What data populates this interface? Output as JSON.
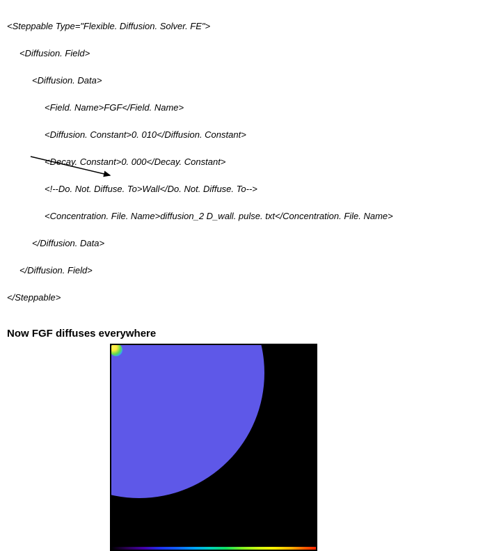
{
  "xml": {
    "l0": "<Steppable Type=\"Flexible. Diffusion. Solver. FE\">",
    "l1": "<Diffusion. Field>",
    "l2": "<Diffusion. Data>",
    "l3": "<Field. Name>FGF</Field. Name>",
    "l4": "<Diffusion. Constant>0. 010</Diffusion. Constant>",
    "l5": "<Decay. Constant>0. 000</Decay. Constant>",
    "l6": "<!--Do. Not. Diffuse. To>Wall</Do. Not. Diffuse. To-->",
    "l7": "<Concentration. File. Name>diffusion_2 D_wall. pulse. txt</Concentration. File. Name>",
    "l8": "</Diffusion. Data>",
    "l9": "</Diffusion. Field>",
    "l10": "</Steppable>"
  },
  "caption": "Now FGF diffuses everywhere"
}
